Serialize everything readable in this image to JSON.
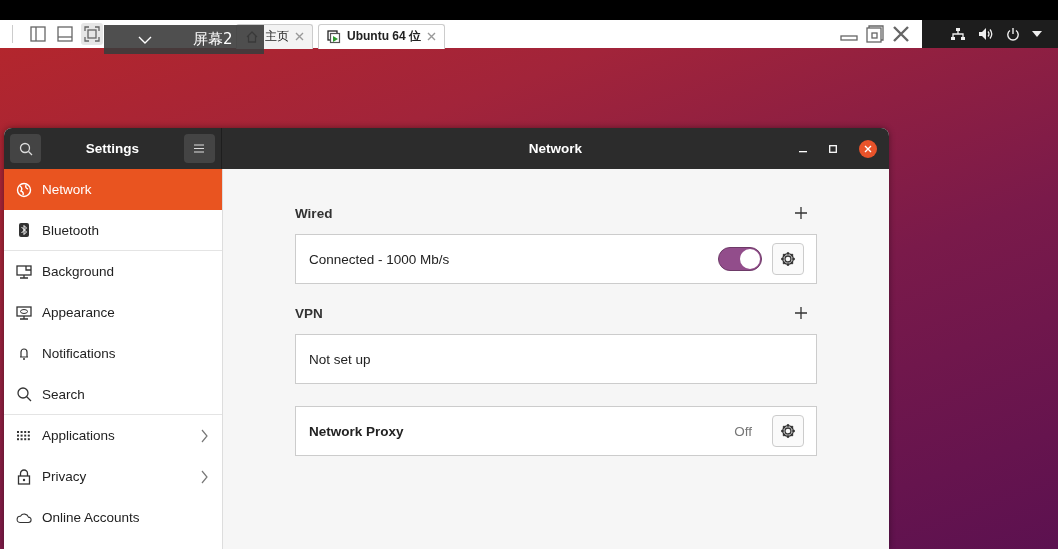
{
  "vm_toolbar": {
    "tabs": [
      {
        "label": "主页",
        "selected": false
      },
      {
        "label": "Ubuntu 64 位",
        "selected": true
      }
    ],
    "tooltip": {
      "label": "屏幕2"
    }
  },
  "settings": {
    "title": "Settings",
    "page_title": "Network",
    "sidebar": {
      "items": [
        {
          "label": "Network",
          "selected": true,
          "expandable": false,
          "separator_after": false
        },
        {
          "label": "Bluetooth",
          "selected": false,
          "expandable": false,
          "separator_after": true
        },
        {
          "label": "Background",
          "selected": false,
          "expandable": false,
          "separator_after": false
        },
        {
          "label": "Appearance",
          "selected": false,
          "expandable": false,
          "separator_after": false
        },
        {
          "label": "Notifications",
          "selected": false,
          "expandable": false,
          "separator_after": false
        },
        {
          "label": "Search",
          "selected": false,
          "expandable": false,
          "separator_after": true
        },
        {
          "label": "Applications",
          "selected": false,
          "expandable": true,
          "separator_after": false
        },
        {
          "label": "Privacy",
          "selected": false,
          "expandable": true,
          "separator_after": false
        },
        {
          "label": "Online Accounts",
          "selected": false,
          "expandable": false,
          "separator_after": false
        }
      ]
    },
    "sections": [
      {
        "title": "Wired",
        "rows": [
          {
            "kind": "switch",
            "label": "Connected - 1000 Mb/s",
            "on": true
          }
        ]
      },
      {
        "title": "VPN",
        "rows": [
          {
            "kind": "text",
            "label": "Not set up"
          }
        ]
      },
      {
        "rows": [
          {
            "kind": "proxy",
            "label": "Network Proxy",
            "value": "Off"
          }
        ]
      }
    ]
  }
}
